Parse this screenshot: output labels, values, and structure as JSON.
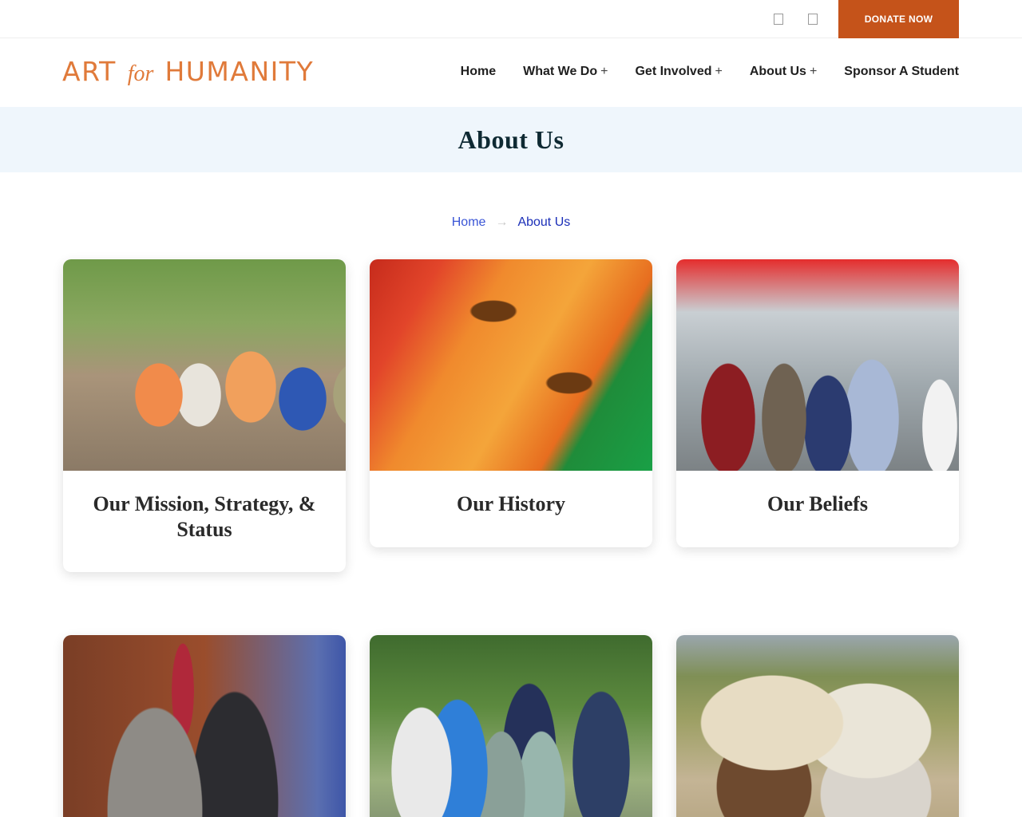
{
  "topbar": {
    "social_icons": [
      "square-icon",
      "square-icon"
    ],
    "donate_label": "DONATE NOW",
    "donate_color": "#c5531a"
  },
  "header": {
    "logo": {
      "art": "ART",
      "for": "for",
      "humanity": "HUMANITY",
      "color": "#e07a3a"
    },
    "nav": [
      {
        "label": "Home",
        "has_submenu": false
      },
      {
        "label": "What We Do",
        "has_submenu": true
      },
      {
        "label": "Get Involved",
        "has_submenu": true
      },
      {
        "label": "About Us",
        "has_submenu": true
      },
      {
        "label": "Sponsor A Student",
        "has_submenu": false
      }
    ],
    "submenu_marker": "+"
  },
  "page": {
    "title": "About Us",
    "title_band_color": "#eff6fc"
  },
  "breadcrumb": {
    "home": "Home",
    "separator": "→",
    "current": "About Us"
  },
  "cards": [
    {
      "label": "Our Mission, Strategy, & Status",
      "image": "children-photo"
    },
    {
      "label": "Our History",
      "image": "painting-photo"
    },
    {
      "label": "Our Beliefs",
      "image": "playground-photo"
    },
    {
      "label": "",
      "image": "officials-photo"
    },
    {
      "label": "",
      "image": "volunteers-photo"
    },
    {
      "label": "",
      "image": "horses-photo"
    }
  ]
}
